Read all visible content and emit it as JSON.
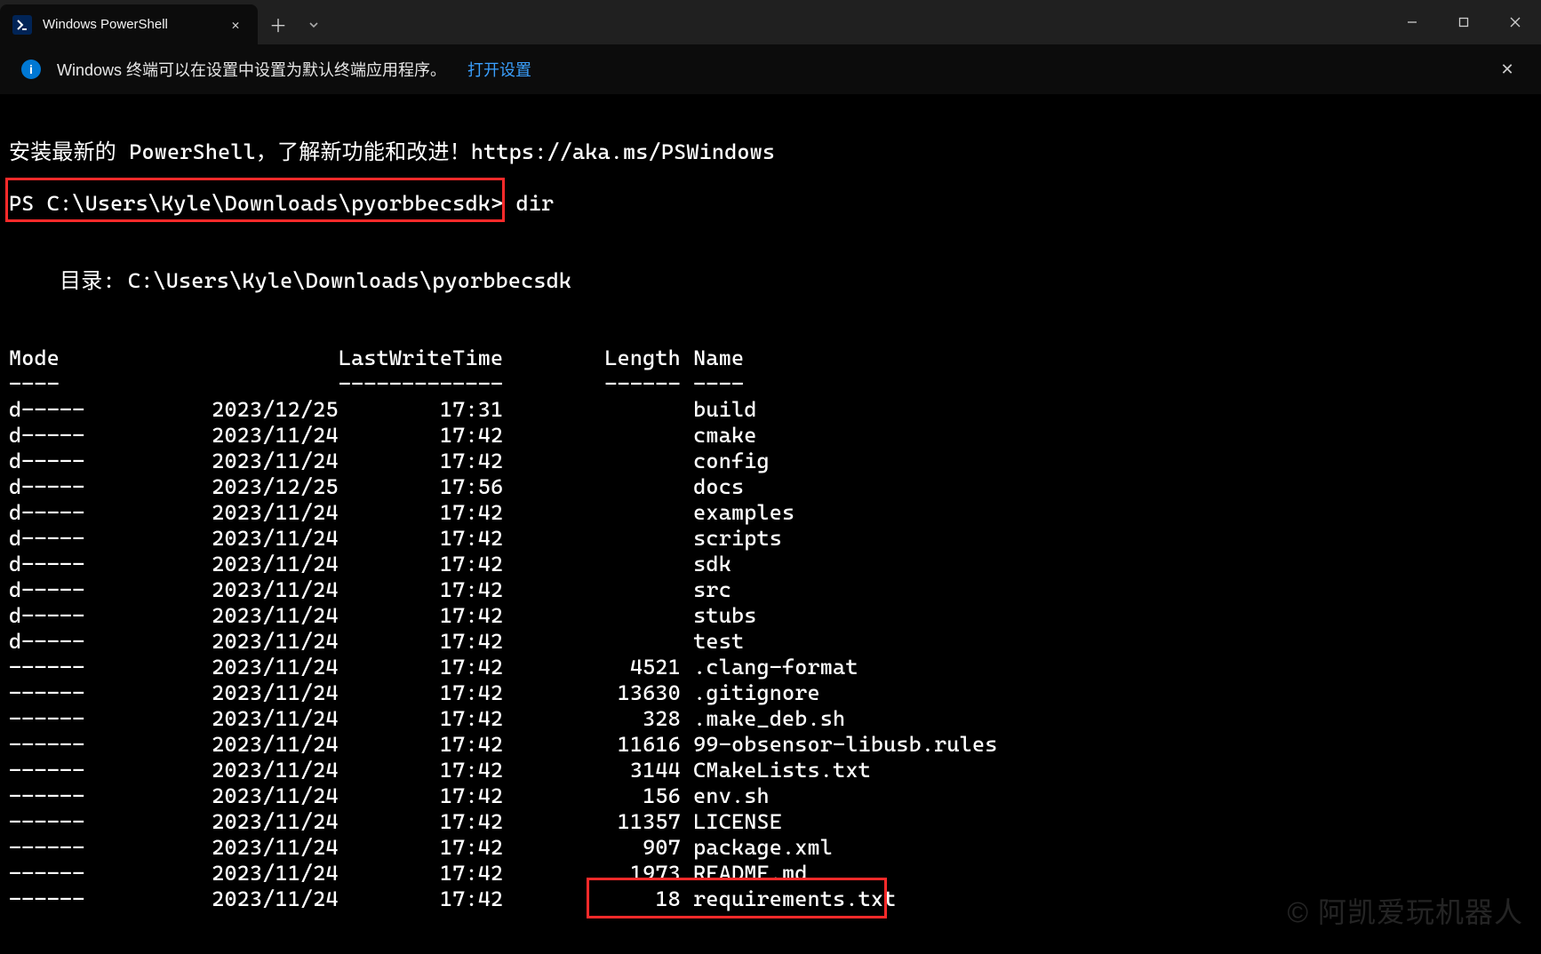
{
  "titlebar": {
    "tab_title": "Windows PowerShell"
  },
  "infobar": {
    "message": "Windows 终端可以在设置中设置为默认终端应用程序。",
    "link": "打开设置"
  },
  "term": {
    "intro": "安装最新的 PowerShell，了解新功能和改进！https://aka.ms/PSWindows",
    "prompt": "PS C:\\Users\\Kyle\\Downloads\\pyorbbecsdk>",
    "command": "dir",
    "dir_label": "    目录: C:\\Users\\Kyle\\Downloads\\pyorbbecsdk",
    "headers": {
      "mode": "Mode",
      "lastwrite": "LastWriteTime",
      "length": "Length",
      "name": "Name"
    },
    "rows": [
      {
        "mode": "d-----",
        "date": "2023/12/25",
        "time": "17:31",
        "length": "",
        "name": "build"
      },
      {
        "mode": "d-----",
        "date": "2023/11/24",
        "time": "17:42",
        "length": "",
        "name": "cmake"
      },
      {
        "mode": "d-----",
        "date": "2023/11/24",
        "time": "17:42",
        "length": "",
        "name": "config"
      },
      {
        "mode": "d-----",
        "date": "2023/12/25",
        "time": "17:56",
        "length": "",
        "name": "docs"
      },
      {
        "mode": "d-----",
        "date": "2023/11/24",
        "time": "17:42",
        "length": "",
        "name": "examples"
      },
      {
        "mode": "d-----",
        "date": "2023/11/24",
        "time": "17:42",
        "length": "",
        "name": "scripts"
      },
      {
        "mode": "d-----",
        "date": "2023/11/24",
        "time": "17:42",
        "length": "",
        "name": "sdk"
      },
      {
        "mode": "d-----",
        "date": "2023/11/24",
        "time": "17:42",
        "length": "",
        "name": "src"
      },
      {
        "mode": "d-----",
        "date": "2023/11/24",
        "time": "17:42",
        "length": "",
        "name": "stubs"
      },
      {
        "mode": "d-----",
        "date": "2023/11/24",
        "time": "17:42",
        "length": "",
        "name": "test"
      },
      {
        "mode": "------",
        "date": "2023/11/24",
        "time": "17:42",
        "length": "4521",
        "name": ".clang-format"
      },
      {
        "mode": "------",
        "date": "2023/11/24",
        "time": "17:42",
        "length": "13630",
        "name": ".gitignore"
      },
      {
        "mode": "------",
        "date": "2023/11/24",
        "time": "17:42",
        "length": "328",
        "name": ".make_deb.sh"
      },
      {
        "mode": "------",
        "date": "2023/11/24",
        "time": "17:42",
        "length": "11616",
        "name": "99-obsensor-libusb.rules"
      },
      {
        "mode": "------",
        "date": "2023/11/24",
        "time": "17:42",
        "length": "3144",
        "name": "CMakeLists.txt"
      },
      {
        "mode": "------",
        "date": "2023/11/24",
        "time": "17:42",
        "length": "156",
        "name": "env.sh"
      },
      {
        "mode": "------",
        "date": "2023/11/24",
        "time": "17:42",
        "length": "11357",
        "name": "LICENSE"
      },
      {
        "mode": "------",
        "date": "2023/11/24",
        "time": "17:42",
        "length": "907",
        "name": "package.xml"
      },
      {
        "mode": "------",
        "date": "2023/11/24",
        "time": "17:42",
        "length": "1973",
        "name": "README.md"
      },
      {
        "mode": "------",
        "date": "2023/11/24",
        "time": "17:42",
        "length": "18",
        "name": "requirements.txt"
      }
    ]
  },
  "watermark": "© 阿凯爱玩机器人"
}
